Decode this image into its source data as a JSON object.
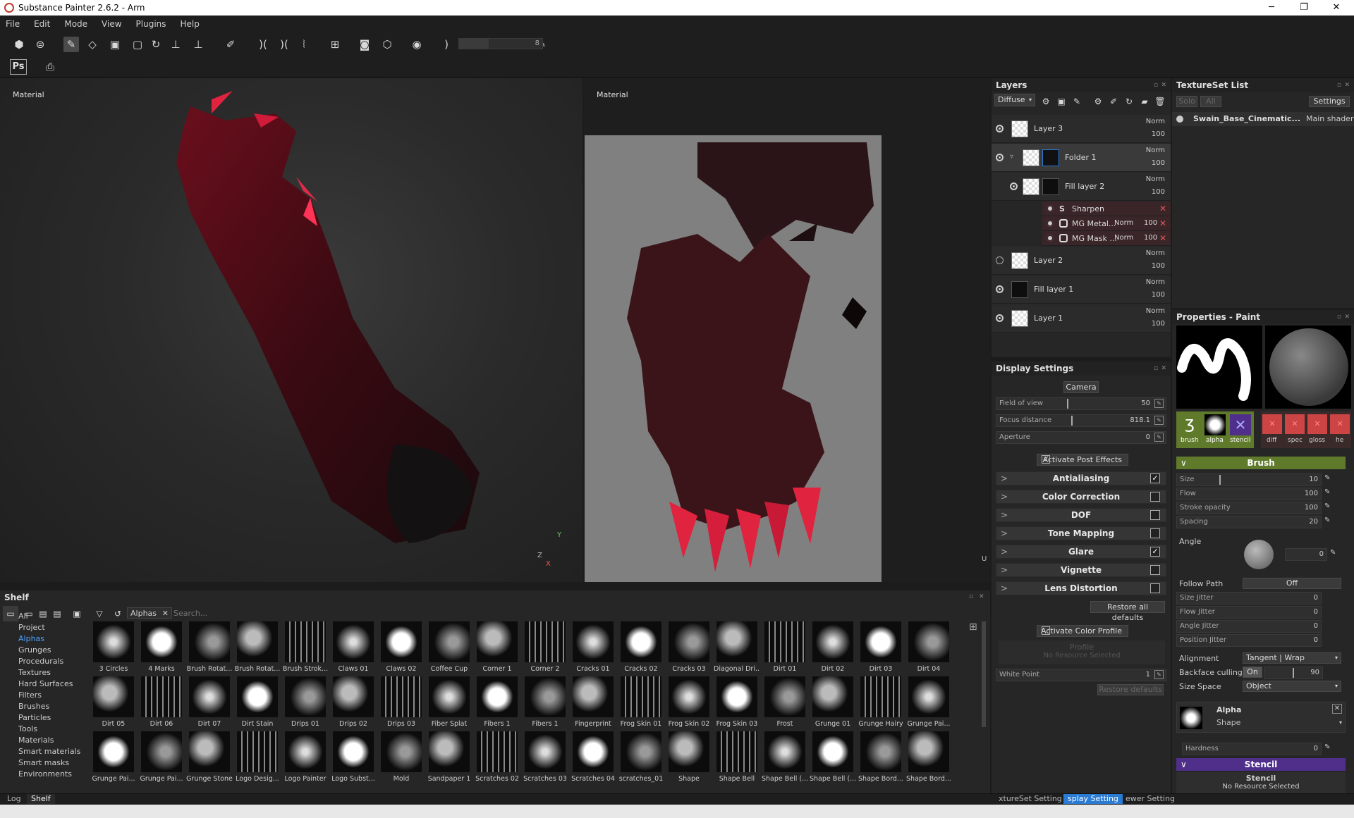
{
  "window": {
    "title": "Substance Painter 2.6.2 - Arm",
    "minimize": "─",
    "maximize": "❐",
    "close": "✕"
  },
  "menu": [
    "File",
    "Edit",
    "Mode",
    "View",
    "Plugins",
    "Help"
  ],
  "toolbar": {
    "brightness_value": "8",
    "ps_label": "Ps"
  },
  "viewport3d": {
    "label": "Material",
    "axis_y": "Y",
    "axis_z": "Z",
    "axis_x": "X"
  },
  "viewport2d": {
    "label": "Material",
    "axis_u": "U"
  },
  "layers_panel": {
    "title": "Layers",
    "channel": "Diffuse",
    "layers": [
      {
        "name": "Layer 3",
        "blend": "Norm",
        "opacity": "100"
      },
      {
        "name": "Folder 1",
        "blend": "Norm",
        "opacity": "100"
      },
      {
        "name": "Fill layer 2",
        "blend": "Norm",
        "opacity": "100"
      },
      {
        "name": "Layer 2",
        "blend": "Norm",
        "opacity": "100"
      },
      {
        "name": "Fill layer 1",
        "blend": "Norm",
        "opacity": "100"
      },
      {
        "name": "Layer 1",
        "blend": "Norm",
        "opacity": "100"
      }
    ],
    "effects": [
      {
        "name": "Sharpen",
        "blend": "",
        "opacity": ""
      },
      {
        "name": "MG Metal...",
        "blend": "Norm",
        "opacity": "100"
      },
      {
        "name": "MG Mask ...",
        "blend": "Norm",
        "opacity": "100"
      }
    ]
  },
  "textureset_panel": {
    "title": "TextureSet List",
    "solo": "Solo",
    "all": "All",
    "settings": "Settings",
    "set_name": "Swain_Base_Cinematic...",
    "shader": "Main shader"
  },
  "display_settings": {
    "title": "Display Settings",
    "camera": "Camera",
    "field_of_view": {
      "label": "Field of view",
      "value": "50"
    },
    "focus_distance": {
      "label": "Focus distance",
      "value": "818.1"
    },
    "aperture": {
      "label": "Aperture",
      "value": "0"
    },
    "activate_post_effects": "Activate Post Effects",
    "effects": [
      {
        "name": "Antialiasing",
        "checked": "✓"
      },
      {
        "name": "Color Correction",
        "checked": ""
      },
      {
        "name": "DOF",
        "checked": ""
      },
      {
        "name": "Tone Mapping",
        "checked": ""
      },
      {
        "name": "Glare",
        "checked": "✓"
      },
      {
        "name": "Vignette",
        "checked": ""
      },
      {
        "name": "Lens Distortion",
        "checked": ""
      }
    ],
    "restore_all": "Restore all defaults",
    "activate_color_profile": "Activate Color Profile",
    "profile": "Profile",
    "no_resource": "No Resource Selected",
    "white_point": {
      "label": "White Point",
      "value": "1"
    },
    "restore_defaults": "Restore defaults"
  },
  "properties": {
    "title": "Properties - Paint",
    "slot_labels": [
      "brush",
      "alpha",
      "stencil"
    ],
    "material_labels": [
      "diff",
      "spec",
      "gloss",
      "he"
    ],
    "brush_section": "Brush",
    "size": {
      "label": "Size",
      "value": "10"
    },
    "flow": {
      "label": "Flow",
      "value": "100"
    },
    "stroke_opacity": {
      "label": "Stroke opacity",
      "value": "100"
    },
    "spacing": {
      "label": "Spacing",
      "value": "20"
    },
    "angle": {
      "label": "Angle",
      "value": "0"
    },
    "follow_path": {
      "label": "Follow Path",
      "value": "Off"
    },
    "size_jitter": {
      "label": "Size Jitter",
      "value": "0"
    },
    "flow_jitter": {
      "label": "Flow Jitter",
      "value": "0"
    },
    "angle_jitter": {
      "label": "Angle Jitter",
      "value": "0"
    },
    "position_jitter": {
      "label": "Position Jitter",
      "value": "0"
    },
    "alignment": {
      "label": "Alignment",
      "value": "Tangent | Wrap"
    },
    "backface_culling": {
      "label": "Backface culling",
      "toggle": "On",
      "value": "90"
    },
    "size_space": {
      "label": "Size Space",
      "value": "Object"
    },
    "alpha_title": "Alpha",
    "alpha_sub": "Shape",
    "hardness": {
      "label": "Hardness",
      "value": "0"
    },
    "stencil_section": "Stencil",
    "stencil_title": "Stencil",
    "stencil_empty": "No Resource Selected"
  },
  "shelf": {
    "title": "Shelf",
    "filter_tag": "Alphas",
    "search_placeholder": "Search...",
    "categories": [
      "All",
      "Project",
      "Alphas",
      "Grunges",
      "Procedurals",
      "Textures",
      "Hard Surfaces",
      "Filters",
      "Brushes",
      "Particles",
      "Tools",
      "Materials",
      "Smart materials",
      "Smart masks",
      "Environments"
    ],
    "items": [
      "3 Circles",
      "4 Marks",
      "Brush Rotat...",
      "Brush Rotat...",
      "Brush Strok...",
      "Claws 01",
      "Claws 02",
      "Coffee Cup",
      "Corner 1",
      "Corner 2",
      "Cracks 01",
      "Cracks 02",
      "Cracks 03",
      "Diagonal Dri...",
      "Dirt 01",
      "Dirt 02",
      "Dirt 03",
      "Dirt 04",
      "Dirt 05",
      "Dirt 06",
      "Dirt 07",
      "Dirt Stain",
      "Drips 01",
      "Drips 02",
      "Drips 03",
      "Fiber Splat",
      "Fibers 1",
      "Fibers 1",
      "Fingerprint",
      "Frog Skin 01",
      "Frog Skin 02",
      "Frog Skin 03",
      "Frost",
      "Grunge 01",
      "Grunge Hairy",
      "Grunge Pai...",
      "Grunge Pai...",
      "Grunge Pai...",
      "Grunge Stone",
      "Logo Desig...",
      "Logo Painter",
      "Logo Subst...",
      "Mold",
      "Sandpaper 1",
      "Scratches 02",
      "Scratches 03",
      "Scratches 04",
      "scratches_01",
      "Shape",
      "Shape Bell",
      "Shape Bell (...",
      "Shape Bell (...",
      "Shape Bord...",
      "Shape Bord..."
    ]
  },
  "bottom_tabs": {
    "log": "Log",
    "shelf": "Shelf",
    "tab1": "xtureSet Setting",
    "tab2": "splay Setting",
    "tab3": "ewer Setting"
  },
  "colors": {
    "accent_green": "#5f7a2a",
    "stencil_purple": "#4f2f8a",
    "selection_blue": "#2a7bd4"
  }
}
